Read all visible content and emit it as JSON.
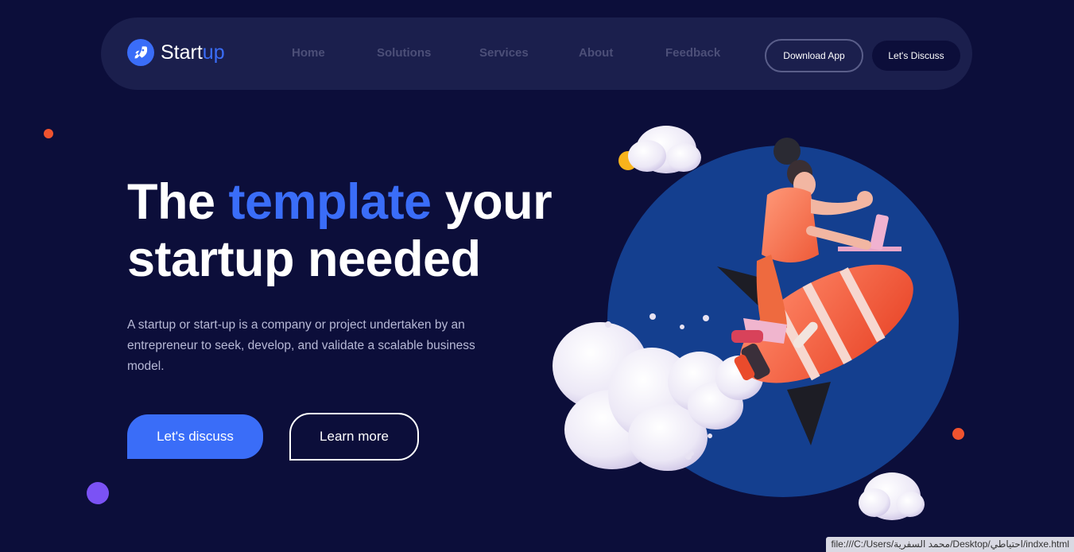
{
  "colors": {
    "background": "#0c0e3a",
    "navbar": "#1b1f4d",
    "accent": "#3a6df8",
    "nav_text": "#4c4f78",
    "orange_dot": "#f0532f",
    "purple_dot": "#7b52f5",
    "yellow_dot": "#f8b31c",
    "circle": "#143f8f"
  },
  "brand": {
    "icon": "rocket-icon",
    "name_main": "Start",
    "name_accent": "up"
  },
  "nav": {
    "items": [
      "Home",
      "Solutions",
      "Services",
      "About",
      "Feedback"
    ],
    "download_label": "Download App",
    "discuss_label": "Let's Discuss"
  },
  "hero": {
    "title_part1": "The ",
    "title_accent": "template",
    "title_part2": " your",
    "title_line2": "startup needed",
    "description": "A startup or start-up is a company or project undertaken by an entrepreneur to seek, develop, and validate a scalable business model.",
    "primary_cta": "Let's discuss",
    "secondary_cta": "Learn more"
  },
  "illustration": {
    "name": "rocket-girl-illustration"
  },
  "status_bar": {
    "url": "file:///C:/Users/محمد السفرية/Desktop/احتياطي/indxe.html"
  }
}
